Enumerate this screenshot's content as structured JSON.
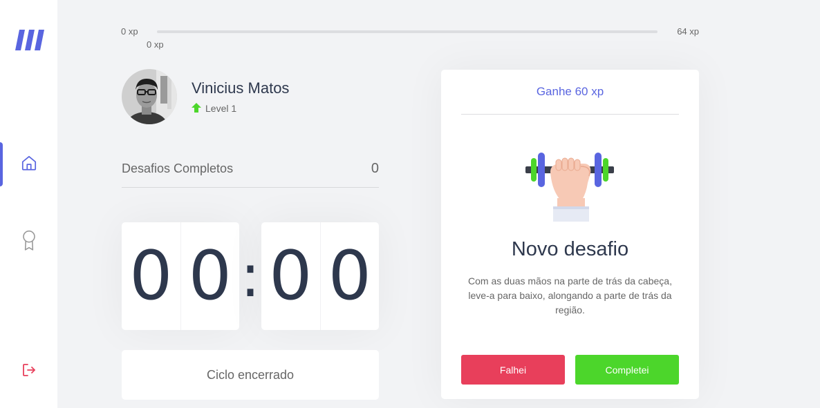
{
  "app": {
    "logo_icon": "logo-icon",
    "accent_color": "#5965e0"
  },
  "sidebar": {
    "items": [
      {
        "name": "home",
        "icon": "home-icon",
        "active": true
      },
      {
        "name": "award",
        "icon": "award-icon",
        "active": false
      },
      {
        "name": "logout",
        "icon": "logout-icon",
        "color": "#e83f5b"
      }
    ]
  },
  "experience": {
    "start_label": "0 xp",
    "current_label": "0 xp",
    "end_label": "64 xp",
    "progress_fraction": 0
  },
  "profile": {
    "name": "Vinicius Matos",
    "level_label": "Level 1",
    "level_icon": "level-up-icon"
  },
  "completed": {
    "label": "Desafios Completos",
    "count": "0"
  },
  "countdown": {
    "minute_left": "0",
    "minute_right": "0",
    "separator": ":",
    "second_left": "0",
    "second_right": "0"
  },
  "cycle_button": {
    "label": "Ciclo encerrado"
  },
  "challenge": {
    "header": "Ganhe 60 xp",
    "icon": "dumbbell-icon",
    "title": "Novo desafio",
    "description": "Com as duas mãos na parte de trás da cabeça, leve-a para baixo, alongando a parte de trás da região.",
    "fail_label": "Falhei",
    "success_label": "Completei",
    "fail_color": "#e83f5b",
    "success_color": "#4cd62b"
  }
}
